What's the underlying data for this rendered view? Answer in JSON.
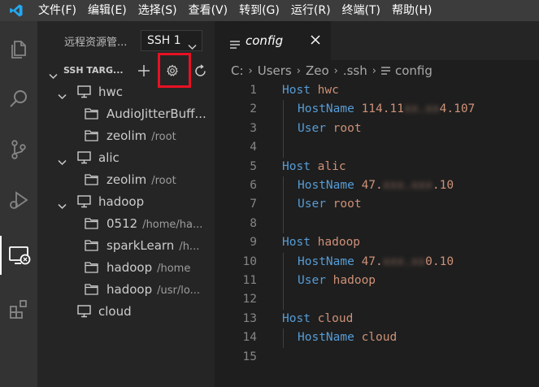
{
  "menu": [
    "文件(F)",
    "编辑(E)",
    "选择(S)",
    "查看(V)",
    "转到(G)",
    "运行(R)",
    "终端(T)",
    "帮助(H)"
  ],
  "sidebar": {
    "title": "远程资源管...",
    "select_value": "SSH 1",
    "section_title": "SSH TARG...",
    "tree": [
      {
        "type": "host",
        "label": "hwc",
        "desc": ""
      },
      {
        "type": "folder",
        "label": "AudioJitterBuff...",
        "desc": ""
      },
      {
        "type": "folder",
        "label": "zeolim",
        "desc": "/root"
      },
      {
        "type": "host",
        "label": "alic",
        "desc": ""
      },
      {
        "type": "folder",
        "label": "zeolim",
        "desc": "/root"
      },
      {
        "type": "host",
        "label": "hadoop",
        "desc": ""
      },
      {
        "type": "folder",
        "label": "0512",
        "desc": "/home/ha..."
      },
      {
        "type": "folder",
        "label": "sparkLearn",
        "desc": "/h..."
      },
      {
        "type": "folder",
        "label": "hadoop",
        "desc": "/home"
      },
      {
        "type": "folder",
        "label": "hadoop",
        "desc": "/usr/lo..."
      },
      {
        "type": "host-leaf",
        "label": "cloud",
        "desc": ""
      }
    ]
  },
  "editor": {
    "tab_label": "config",
    "breadcrumb": [
      "C:",
      "Users",
      "Zeo",
      ".ssh",
      "config"
    ],
    "lines": [
      {
        "n": "1",
        "kw": "Host",
        "val": "hwc",
        "indent": false
      },
      {
        "n": "2",
        "kw": "HostName",
        "val": "114.11",
        "blur": "xx.xx",
        "tail": "4.107",
        "indent": true
      },
      {
        "n": "3",
        "kw": "User",
        "val": "root",
        "indent": true
      },
      {
        "n": "4",
        "kw": "",
        "val": "",
        "indent": true
      },
      {
        "n": "5",
        "kw": "Host",
        "val": "alic",
        "indent": false
      },
      {
        "n": "6",
        "kw": "HostName",
        "val": "47.",
        "blur": "xxx.xxx",
        "tail": ".10",
        "indent": true
      },
      {
        "n": "7",
        "kw": "User",
        "val": "root",
        "indent": true
      },
      {
        "n": "8",
        "kw": "",
        "val": "",
        "indent": true
      },
      {
        "n": "9",
        "kw": "Host",
        "val": "hadoop",
        "indent": false
      },
      {
        "n": "10",
        "kw": "HostName",
        "val": "47.",
        "blur": "xxx.xx",
        "tail": "0.10",
        "indent": true
      },
      {
        "n": "11",
        "kw": "User",
        "val": "hadoop",
        "indent": true
      },
      {
        "n": "12",
        "kw": "",
        "val": "",
        "indent": true
      },
      {
        "n": "13",
        "kw": "Host",
        "val": "cloud",
        "indent": false
      },
      {
        "n": "14",
        "kw": "HostName",
        "val": "cloud",
        "indent": true
      },
      {
        "n": "15",
        "kw": "",
        "val": "",
        "indent": false
      }
    ]
  },
  "colors": {
    "accent_box": "#e81123",
    "keyword": "#569cd6",
    "string": "#ce9178",
    "vscode_blue": "#23a9f2"
  },
  "icons": [
    "vscode-logo-icon",
    "explorer-icon",
    "search-icon",
    "source-control-icon",
    "run-debug-icon",
    "remote-explorer-icon",
    "extensions-icon",
    "add-icon",
    "gear-icon",
    "refresh-icon",
    "monitor-icon",
    "folder-icon",
    "chevron-down-icon",
    "close-icon",
    "lines-file-icon"
  ]
}
